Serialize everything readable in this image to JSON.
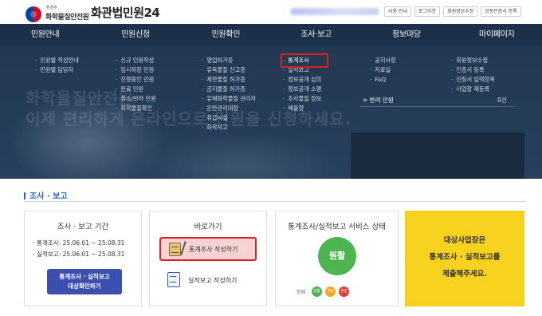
{
  "header": {
    "ministry": "환경부",
    "institute": "화학물질안전원",
    "site_title": "화관법민원24",
    "buttons": [
      "사용 안내",
      "로그아웃",
      "회원정보수정",
      "공동인증서 등록"
    ]
  },
  "nav": [
    "민원안내",
    "민원신청",
    "민원확인",
    "조사·보고",
    "정보마당",
    "마이페이지"
  ],
  "mega": {
    "ghost_text": [
      "화학물질안전원",
      "이제 편리하게 온라인으로 민원을 신청하세요."
    ],
    "col1": [
      "민원별 작성안내",
      "민원별 담당자"
    ],
    "col2": [
      "신규 민원작성",
      "임시저장 민원",
      "진행중인 민원",
      "완료 민원",
      "취소/반려 민원",
      "화학물질확인"
    ],
    "col3": [
      "영업허가증",
      "유독물질 신고증",
      "제한물질 허가증",
      "금지물질 허가증",
      "유해화학물질 관리자",
      "운반관리대장",
      "취급시설",
      "화학사고"
    ],
    "col4": [
      "통계조사",
      "실적보고",
      "정보공개 심의",
      "정보공개 소명",
      "조사물질 정보",
      "배출량"
    ],
    "col5": [
      "공지사항",
      "자료실",
      "FAQ"
    ],
    "col6": [
      "회원정보수정",
      "인증서 등록",
      "신청서 입력항목",
      "사업장 재등록"
    ],
    "panel_label": "> 반려 민원",
    "panel_count": "0건"
  },
  "section": {
    "title": "조사 · 보고"
  },
  "cards": {
    "period": {
      "title": "조사 · 보고 기간",
      "line1": "- 통계조사:  25.06.01 ~ 25.08.31",
      "line2": "- 실적보고:  25.06.01 ~ 25.08.31",
      "button_l1": "통계조사 · 실적보고",
      "button_l2": "대상확인하기"
    },
    "shortcut": {
      "title": "바로가기",
      "item1": "통계조사 작성하기",
      "item2": "실적보고 작성하기"
    },
    "status": {
      "title": "통계조사/실적보고 서비스 상태",
      "state": "원활",
      "legend_label": "범례 :",
      "legend": [
        "원활",
        "지연",
        "혼잡"
      ]
    },
    "notice": {
      "line1": "대상사업장은",
      "line2": "통계조사 · 실적보고를",
      "line3": "제출해주세요."
    }
  },
  "colors": {
    "nav_bg": "#1d3049",
    "accent_red": "#e02020",
    "status_green": "#4db54f",
    "notice_yellow": "#f7d21e",
    "button_blue": "#3b4fae"
  }
}
